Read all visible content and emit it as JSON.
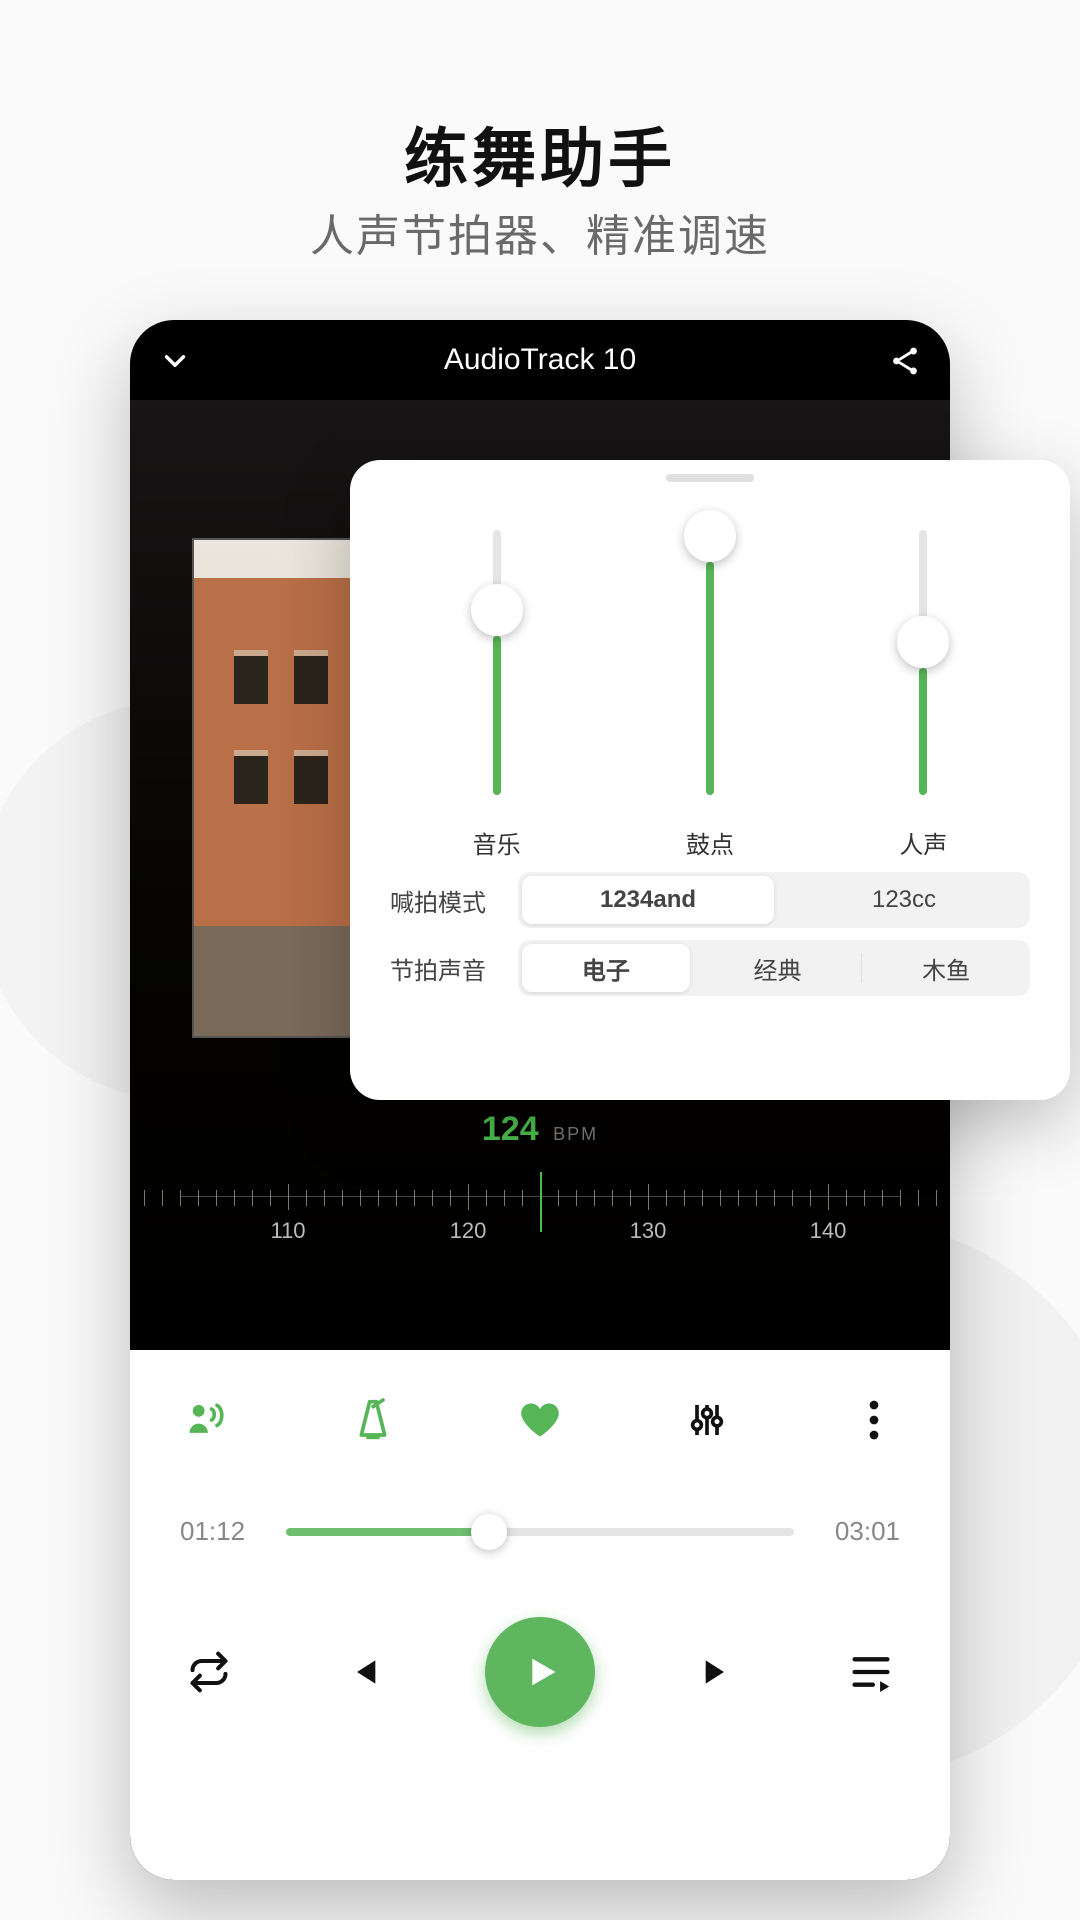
{
  "promo": {
    "headline": "练舞助手",
    "subhead": "人声节拍器、精准调速"
  },
  "player": {
    "title": "AudioTrack 10",
    "bpm": {
      "value": "124",
      "unit": "BPM"
    },
    "ruler_ticks": [
      "110",
      "120",
      "130",
      "140"
    ],
    "time_current": "01:12",
    "time_total": "03:01",
    "progress_pct": 40
  },
  "panel": {
    "sliders": [
      {
        "label": "音乐",
        "value_pct": 60
      },
      {
        "label": "鼓点",
        "value_pct": 88
      },
      {
        "label": "人声",
        "value_pct": 48
      }
    ],
    "count_mode": {
      "label": "喊拍模式",
      "options": [
        "1234and",
        "123cc"
      ],
      "selected": 0
    },
    "beat_sound": {
      "label": "节拍声音",
      "options": [
        "电子",
        "经典",
        "木鱼"
      ],
      "selected": 0
    }
  },
  "colors": {
    "accent": "#56b556"
  }
}
